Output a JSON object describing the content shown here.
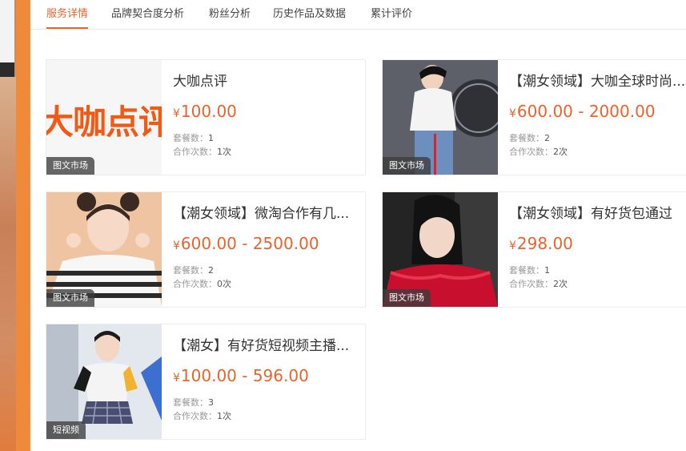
{
  "tabs": [
    {
      "label": "服务详情",
      "active": true
    },
    {
      "label": "品牌契合度分析",
      "active": false
    },
    {
      "label": "粉丝分析",
      "active": false
    },
    {
      "label": "历史作品及数据",
      "active": false
    },
    {
      "label": "累计评价",
      "active": false
    }
  ],
  "meta_labels": {
    "packages": "套餐数：",
    "cooperations": "合作次数："
  },
  "currency": "¥",
  "cards": [
    {
      "title": "大咖点评",
      "price": "100.00",
      "packages": "1",
      "cooperations": "1次",
      "badge": "图文市场",
      "thumb_text": "大咖点评"
    },
    {
      "title": "【潮女领域】大咖全球时尚...",
      "price": "600.00 - 2000.00",
      "packages": "2",
      "cooperations": "2次",
      "badge": "图文市场"
    },
    {
      "title": "【潮女领域】微淘合作有几...",
      "price": "600.00 - 2500.00",
      "packages": "2",
      "cooperations": "0次",
      "badge": "图文市场"
    },
    {
      "title": "【潮女领域】有好货包通过",
      "price": "298.00",
      "packages": "1",
      "cooperations": "2次",
      "badge": "图文市场"
    },
    {
      "title": "【潮女】有好货短视频主播...",
      "price": "100.00 - 596.00",
      "packages": "3",
      "cooperations": "1次",
      "badge": "短视频"
    }
  ],
  "colors": {
    "accent": "#e8642c",
    "price": "#e8642c",
    "badge_bg": "#3c3c3c"
  }
}
